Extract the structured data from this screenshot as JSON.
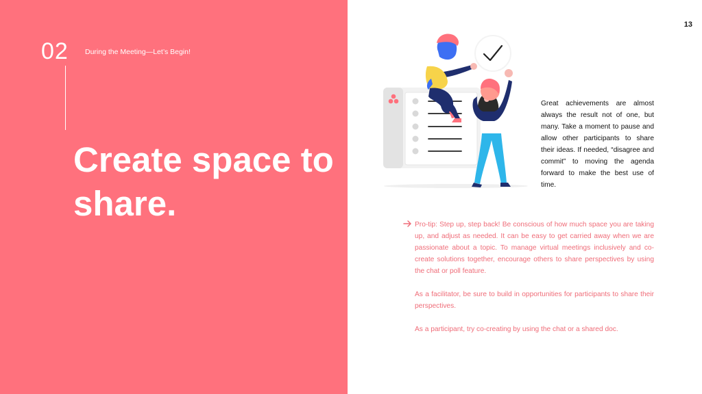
{
  "header": {
    "section_number": "02",
    "section_title": "During the Meeting—Let’s Begin!",
    "page_number": "13"
  },
  "headline": "Create space to share.",
  "body_text": "Great achievements are almost always  the result not of one, but many. Take a moment to pause and allow other participants to share their ideas. If needed, “disagree and commit” to moving the agenda forward to make the best use of time.",
  "tip": {
    "paragraphs": [
      "Pro-tip:  Step up, step back! Be conscious of how much space you are taking up, and adjust as needed. It can be easy to get carried away when we are passionate about a topic. To manage virtual meetings inclusively and co-create solutions together, encourage others to share perspectives by using the chat or poll feature.",
      "As a facilitator, be sure to build in opportunities for participants to share their perspectives.",
      "As a participant, try co-creating by using the chat or a shared doc."
    ]
  },
  "colors": {
    "accent": "#ff717d",
    "tip_text": "#ef6c78",
    "illustration_blue": "#1f2e6e",
    "illustration_yellow": "#f7d34a",
    "illustration_cyan": "#2eb6ea"
  },
  "icons": [
    "arrow-right-icon",
    "checkmark-icon",
    "checklist-document-icon",
    "three-dots-logo-icon"
  ]
}
